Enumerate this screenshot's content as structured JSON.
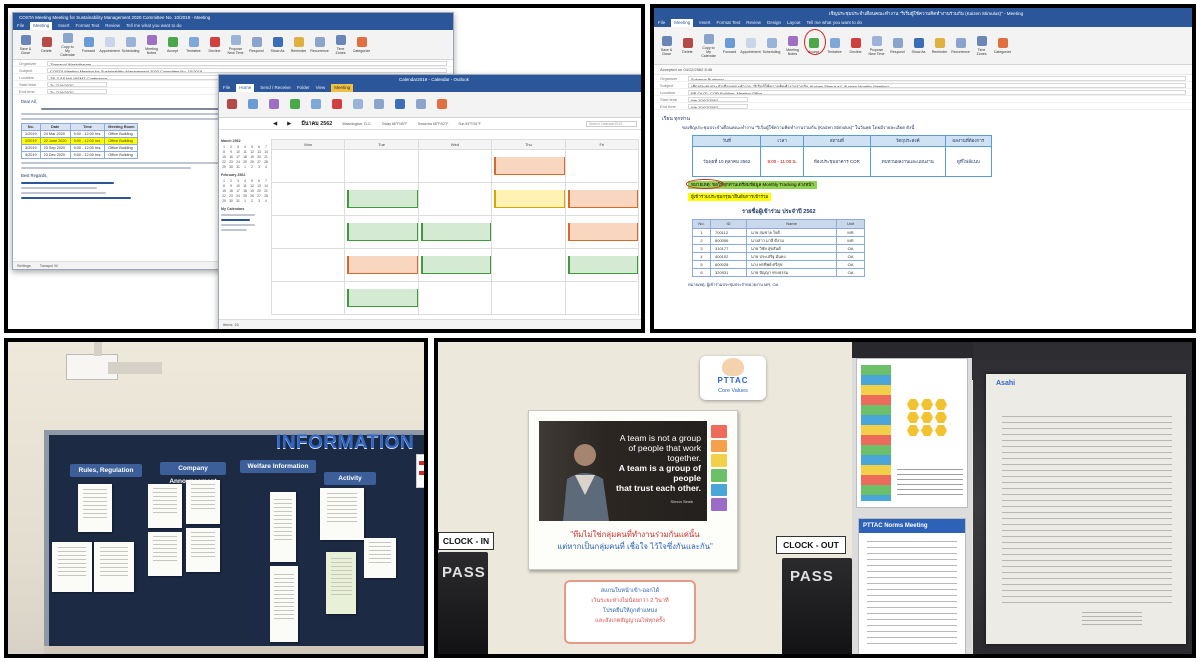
{
  "panel1": {
    "meeting_window": {
      "title": "COSTA Meeting Meeting for Sustainability Management 2020 Committee No. 10/2019 - Meeting",
      "tabs": [
        "File",
        "Meeting",
        "Insert",
        "Format Text",
        "Review",
        "Tell me what you want to do"
      ],
      "ribbon": [
        "Save & Close",
        "Delete",
        "Copy to My Calendar",
        "Forward",
        "Appointment",
        "Scheduling",
        "Meeting Notes",
        "Accept",
        "Tentative",
        "Decline",
        "Propose New Time",
        "Respond",
        "Show As",
        "Reminder",
        "Recurrence",
        "Time Zones",
        "Categorize"
      ],
      "fields": [
        {
          "label": "Organizer",
          "value": "Thanapol Wasintharam"
        },
        {
          "label": "Subject",
          "value": "COSTA Meeting Meeting for Sustainability Management 2020 Committee No. 10/2019"
        },
        {
          "label": "Location",
          "value": "TB-3-ASAHI-WSMT Conference"
        },
        {
          "label": "Start time",
          "value": "Tu 7/16/2020"
        },
        {
          "label": "End time",
          "value": "Tu 7/16/2020"
        }
      ],
      "greeting": "Dear All,",
      "table_headers": [
        "No.",
        "Date",
        "Time",
        "Meeting Room"
      ],
      "table_rows": [
        [
          "1/2019",
          "24 Mar 2020",
          "9:00 - 12:00 hrs.",
          "Office Building"
        ],
        [
          "2/2019",
          "22 June 2020",
          "9:00 - 12:00 hrs.",
          "Office Building"
        ],
        [
          "3/2019",
          "23 Sep 2020",
          "9:00 - 12:00 hrs.",
          "Office Building"
        ],
        [
          "4/2019",
          "23 Dec 2020",
          "9:00 - 12:00 hrs.",
          "Office Building"
        ]
      ],
      "signoff": "Best Regards,",
      "status_left": "Settings",
      "status_right": "Tanapol W."
    },
    "calendar_window": {
      "title": "Calendar2019 - Calendar - Outlook",
      "tabs": [
        "File",
        "Home",
        "Send / Receive",
        "Folder",
        "View",
        "Meeting"
      ],
      "month_label": "มีนาคม 2562",
      "location": "Washington, D.C.",
      "weather": [
        "Today 68°F/45°F",
        "Tomorrow 68°F/52°F",
        "Sun 54°F/34°F"
      ],
      "search_placeholder": "Search Calendar2019",
      "minicals": [
        "March 2562",
        "February 2562"
      ],
      "my_calendars_label": "My Calendars",
      "day_headers": [
        "Mon",
        "Tue",
        "Wed",
        "Thu",
        "Fri"
      ],
      "status_left": "Items: 16"
    }
  },
  "panel2": {
    "title": "เชิญประชุมประจำเดือนคณะทำงาน \"ริเริ่มผู้ใช้ความคิดทำงานร่วมกัน (Kaizen Stimulus)\" - Meeting",
    "tabs": [
      "File",
      "Meeting",
      "Insert",
      "Format Text",
      "Review",
      "Design",
      "Layout",
      "Tell me what you want to do"
    ],
    "ribbon": [
      "Save & Close",
      "Delete",
      "Copy to My Calendar",
      "Forward",
      "Appointment",
      "Scheduling",
      "Meeting Notes",
      "Accept",
      "Tentative",
      "Decline",
      "Propose New Time",
      "Respond",
      "Show As",
      "Reminder",
      "Recurrence",
      "Time Zones",
      "Categorize"
    ],
    "info_bar": "Accepted on 04/12/2562 8:46",
    "fields": [
      {
        "label": "Organizer",
        "value": "Sukanya Pudpong"
      },
      {
        "label": "Subject",
        "value": "เชิญประชุมประจำเดือนคณะทำงาน \"ริเริ่มผู้ใช้ความคิดทำงานร่วมกัน (Kaizen Stimulus)\" (Kaizen Monthly Meeting)"
      },
      {
        "label": "Location",
        "value": "PP-OL/TL-COR Building, Meeting Office"
      },
      {
        "label": "Start time",
        "value": "We 10/07/2562"
      },
      {
        "label": "End time",
        "value": "We 10/07/2562"
      }
    ],
    "greeting": "เรียน ทุกท่าน",
    "intro": "ขอเชิญประชุมประจำเดือนคณะทำงาน \"ริเริ่มผู้ใช้ความคิดทำงานร่วมกัน (Kaizen Stimulus)\" ในวันพุธ โดยมีรายละเอียด ดังนี้",
    "table_headers": [
      "วันที่",
      "เวลา",
      "สถานที่",
      "วัตถุประสงค์",
      "ผลงานที่ต้องการ"
    ],
    "table_row": [
      "วันพุธที่ 10 ตุลาคม 2562",
      "9:00 - 11:00 น.",
      "ห้องประชุมอาคาร COR",
      "ทบทวนผลงานและแผนงาน",
      "ดูที่ไฟล์แนบ"
    ],
    "highlight1": "หมายเหตุ: ขอให้ทุกท่านเตรียมข้อมูล Monthly Tracking ล่วงหน้า",
    "highlight2": "ผู้เข้าร่วมประชุมกรุณายืนยันการเข้าร่วม",
    "members_title": "รายชื่อผู้เข้าร่วม ประจำปี 2562",
    "members_headers": [
      "No.",
      "ID",
      "Name",
      "Unit"
    ],
    "members": [
      [
        "1",
        "700112",
        "นาย สมชาย ใจดี",
        "MR"
      ],
      [
        "2",
        "800056",
        "นางสาว มาลี ดีงาม",
        "MR"
      ],
      [
        "3",
        "310177",
        "นาย วิชัย สุขสันต์",
        "OA"
      ],
      [
        "4",
        "400102",
        "นาย ประเสริฐ มั่นคง",
        "OA"
      ],
      [
        "5",
        "600028",
        "นาง พรทิพย์ ศรีสุข",
        "OA"
      ],
      [
        "6",
        "320931",
        "นาย ปัญญา ทรงธรรม",
        "OA"
      ]
    ],
    "footer_note": "หมายเหตุ: ผู้เข้าร่วมประชุมประจำหน่วยงาน MR, OA"
  },
  "panel3": {
    "board_title": "INFORMATION",
    "categories": [
      "Rules, Regulation",
      "Company Announcement",
      "Welfare Information",
      "Activity"
    ]
  },
  "panel4": {
    "values_logo": "PTTAC",
    "values_subtitle": "Core Values",
    "quote": [
      "A team is not a group",
      "of people that work together.",
      "A team is a group of people",
      "that trust each other."
    ],
    "quote_author": "Simon Sinek",
    "thai_line1": "\"ทีมไม่ใช่กลุ่มคนที่ทำงานร่วมกันแค่นั้น",
    "thai_line2": "แต่หากเป็นกลุ่มคนที่ เชื่อใจ ไว้ใจซึ่งกันและกัน\"",
    "clock_in": "CLOCK - IN",
    "clock_out": "CLOCK - OUT",
    "pass": "PASS",
    "notice_lines": [
      "สแกนใบหน้าเข้า-ออกได้",
      "เว้นระยะห่างไม่น้อยกว่า 2 วินาที",
      "โปรดยืนให้ถูกตำแหน่ง",
      "และสังเกตสัญญาณไฟทุกครั้ง"
    ],
    "stand_title": "PTTAC Norms Meeting",
    "glass_logo": "Asahi",
    "colors": {
      "outlook_blue": "#2b579a",
      "board_blue": "#2f66c6",
      "quote_red": "#d22e2e"
    }
  }
}
